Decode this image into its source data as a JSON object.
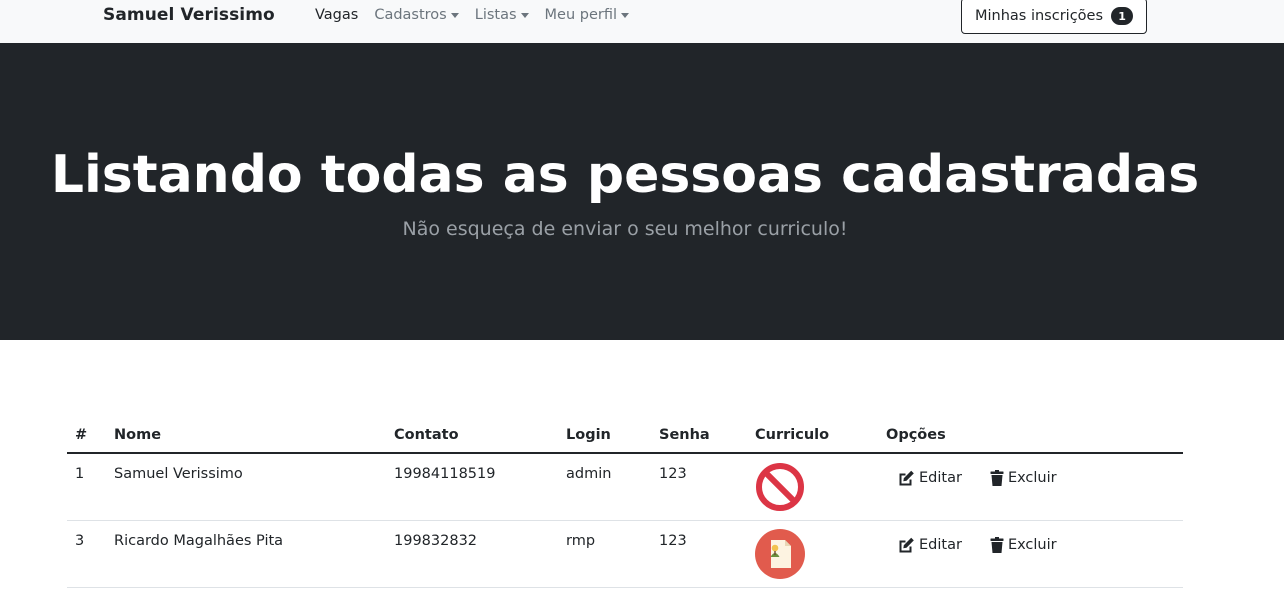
{
  "navbar": {
    "brand": "Samuel Verissimo",
    "items": [
      {
        "label": "Vagas",
        "dropdown": false,
        "active": true
      },
      {
        "label": "Cadastros",
        "dropdown": true,
        "active": false
      },
      {
        "label": "Listas",
        "dropdown": true,
        "active": false
      },
      {
        "label": "Meu perfil",
        "dropdown": true,
        "active": false
      }
    ],
    "inscricoes": {
      "label": "Minhas inscrições",
      "count": "1"
    }
  },
  "hero": {
    "title": "Listando todas as pessoas cadastradas",
    "subtitle": "Não esqueça de enviar o seu melhor curriculo!"
  },
  "table": {
    "headers": [
      "#",
      "Nome",
      "Contato",
      "Login",
      "Senha",
      "Curriculo",
      "Opções"
    ],
    "rows": [
      {
        "id": "1",
        "nome": "Samuel Verissimo",
        "contato": "19984118519",
        "login": "admin",
        "senha": "123",
        "curriculo": "no-curriculum-icon",
        "edit": "Editar",
        "delete": "Excluir"
      },
      {
        "id": "3",
        "nome": "Ricardo Magalhães Pita",
        "contato": "199832832",
        "login": "rmp",
        "senha": "123",
        "curriculo": "curriculum-document-icon",
        "edit": "Editar",
        "delete": "Excluir"
      }
    ]
  },
  "colors": {
    "navbar_bg": "#f8f9fa",
    "hero_bg": "#212529",
    "ban_red": "#dc3545",
    "doc_red": "#e15b4d"
  }
}
